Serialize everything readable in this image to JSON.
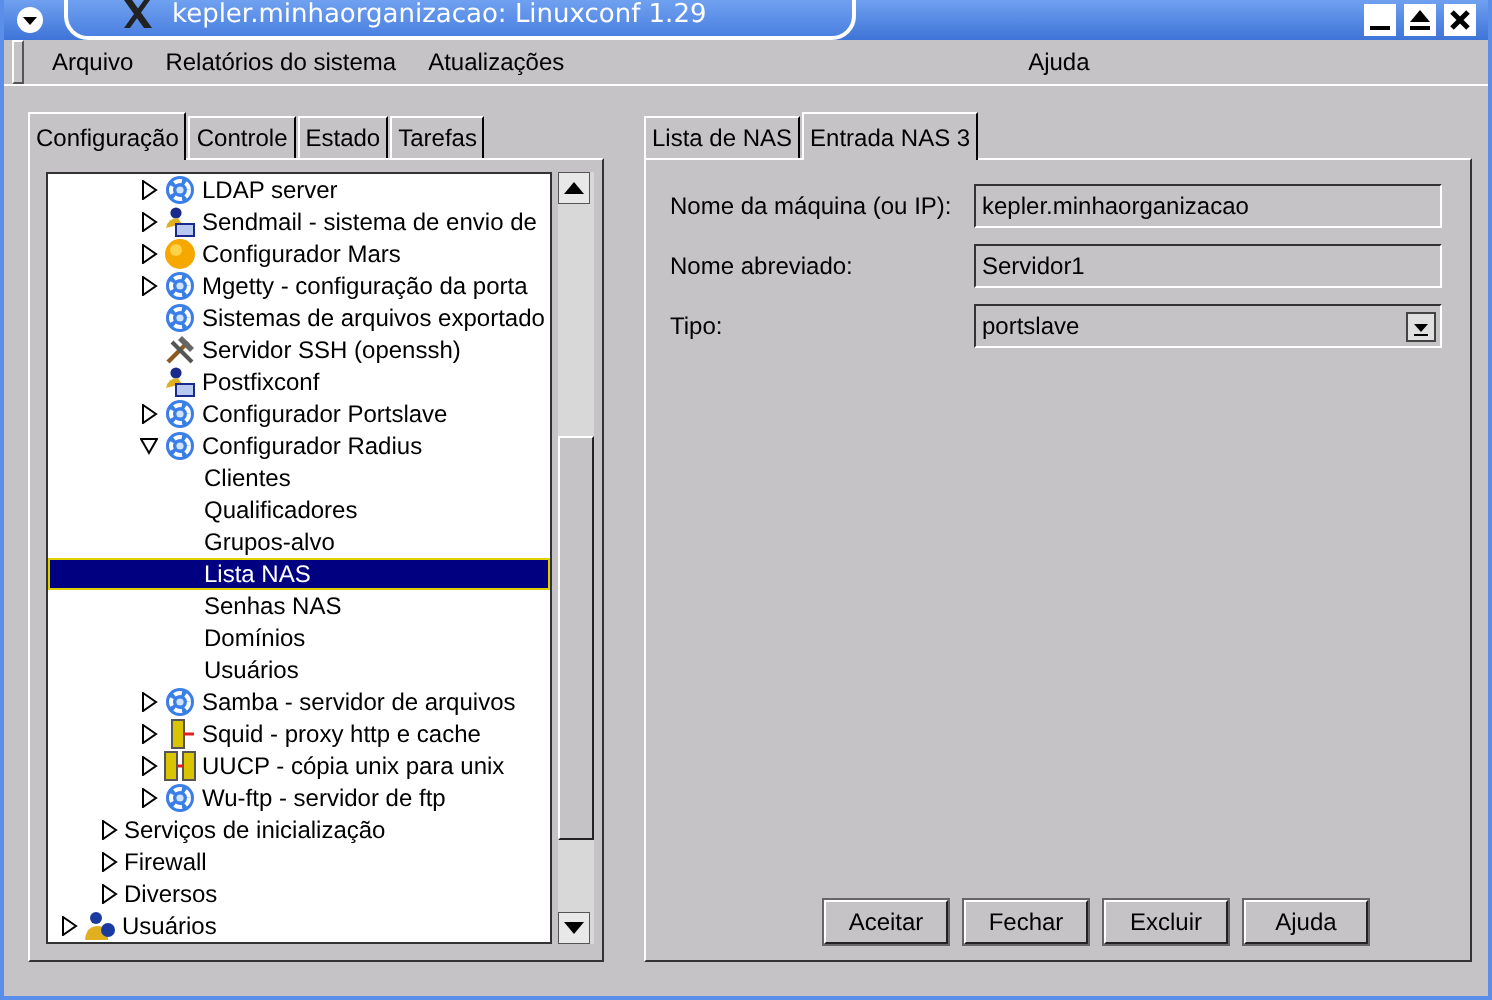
{
  "window": {
    "title": "kepler.minhaorganizacao: Linuxconf 1.29"
  },
  "menu": [
    "Arquivo",
    "Relatórios do sistema",
    "Atualizações"
  ],
  "menu_right": "Ajuda",
  "left_tabs": [
    {
      "label": "Configuração",
      "selected": true
    },
    {
      "label": "Controle",
      "selected": false
    },
    {
      "label": "Estado",
      "selected": false
    },
    {
      "label": "Tarefas",
      "selected": false
    }
  ],
  "tree": [
    {
      "children": [
        {
          "children": [
            {
              "label": "LDAP server",
              "kind": "gear",
              "expanded": false,
              "selected": false
            },
            {
              "label": "Sendmail - sistema de envio de",
              "kind": "mailer",
              "expanded": false,
              "selected": false
            },
            {
              "label": "Configurador Mars",
              "kind": "sun",
              "expanded": false,
              "selected": false
            },
            {
              "label": "Mgetty - configuração da porta",
              "kind": "gear",
              "expanded": false,
              "selected": false
            },
            {
              "label": "Sistemas de arquivos exportado",
              "kind": "gear",
              "selected": false
            },
            {
              "label": "Servidor SSH (openssh)",
              "kind": "tools",
              "selected": false
            },
            {
              "label": "Postfixconf",
              "kind": "mailer",
              "selected": false
            },
            {
              "label": "Configurador Portslave",
              "kind": "gear",
              "expanded": false,
              "selected": false
            },
            {
              "label": "Configurador Radius",
              "kind": "gear",
              "expanded": true,
              "selected": false,
              "children": [
                {
                  "label": "Clientes",
                  "selected": false
                },
                {
                  "label": "Qualificadores",
                  "selected": false
                },
                {
                  "label": "Grupos-alvo",
                  "selected": false
                },
                {
                  "label": "Lista NAS",
                  "selected": true
                },
                {
                  "label": "Senhas NAS",
                  "selected": false
                },
                {
                  "label": "Domínios",
                  "selected": false
                },
                {
                  "label": "Usuários",
                  "selected": false
                }
              ]
            },
            {
              "label": "Samba - servidor de arquivos",
              "kind": "gear",
              "expanded": false,
              "selected": false
            },
            {
              "label": "Squid - proxy http e cache",
              "kind": "server",
              "expanded": false,
              "selected": false
            },
            {
              "label": "UUCP - cópia unix para unix",
              "kind": "servers",
              "expanded": false,
              "selected": false
            },
            {
              "label": "Wu-ftp - servidor de ftp",
              "kind": "gear",
              "expanded": false,
              "selected": false
            }
          ]
        },
        {
          "label": "Serviços de inicialização",
          "expanded": false,
          "selected": false
        },
        {
          "label": "Firewall",
          "expanded": false,
          "selected": false
        },
        {
          "label": "Diversos",
          "expanded": false,
          "selected": false
        }
      ]
    },
    {
      "label": "Usuários",
      "kind": "users",
      "expanded": false,
      "selected": false
    }
  ],
  "right_tabs": [
    {
      "label": "Lista de NAS",
      "selected": false
    },
    {
      "label": "Entrada NAS 3",
      "selected": true
    }
  ],
  "form": [
    {
      "label": "Nome da máquina (ou IP):",
      "kind": "text",
      "value": "kepler.minhaorganizacao"
    },
    {
      "label": "Nome abreviado:",
      "kind": "text",
      "value": "Servidor1"
    },
    {
      "label": "Tipo:",
      "kind": "combo",
      "value": "portslave"
    }
  ],
  "buttons": [
    "Aceitar",
    "Fechar",
    "Excluir",
    "Ajuda"
  ]
}
